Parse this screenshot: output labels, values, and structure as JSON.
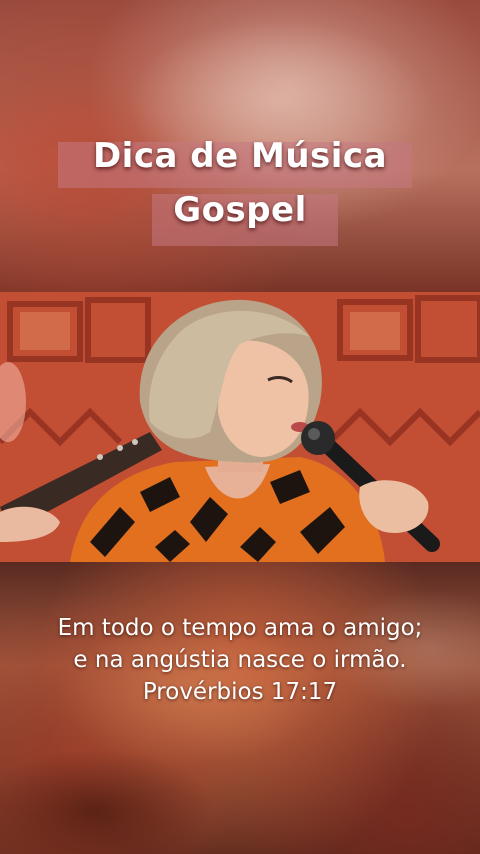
{
  "title": {
    "line1": "Dica de Música",
    "line2": "Gospel"
  },
  "video": {
    "scene": "singer-performing-with-microphone"
  },
  "verse": {
    "line1": "Em todo o tempo ama o amigo;",
    "line2": "e na angústia nasce o irmão.",
    "reference": "Provérbios 17:17"
  },
  "colors": {
    "title_band": "#c47882",
    "text": "#ffffff",
    "stage_background": "#c9563a"
  }
}
